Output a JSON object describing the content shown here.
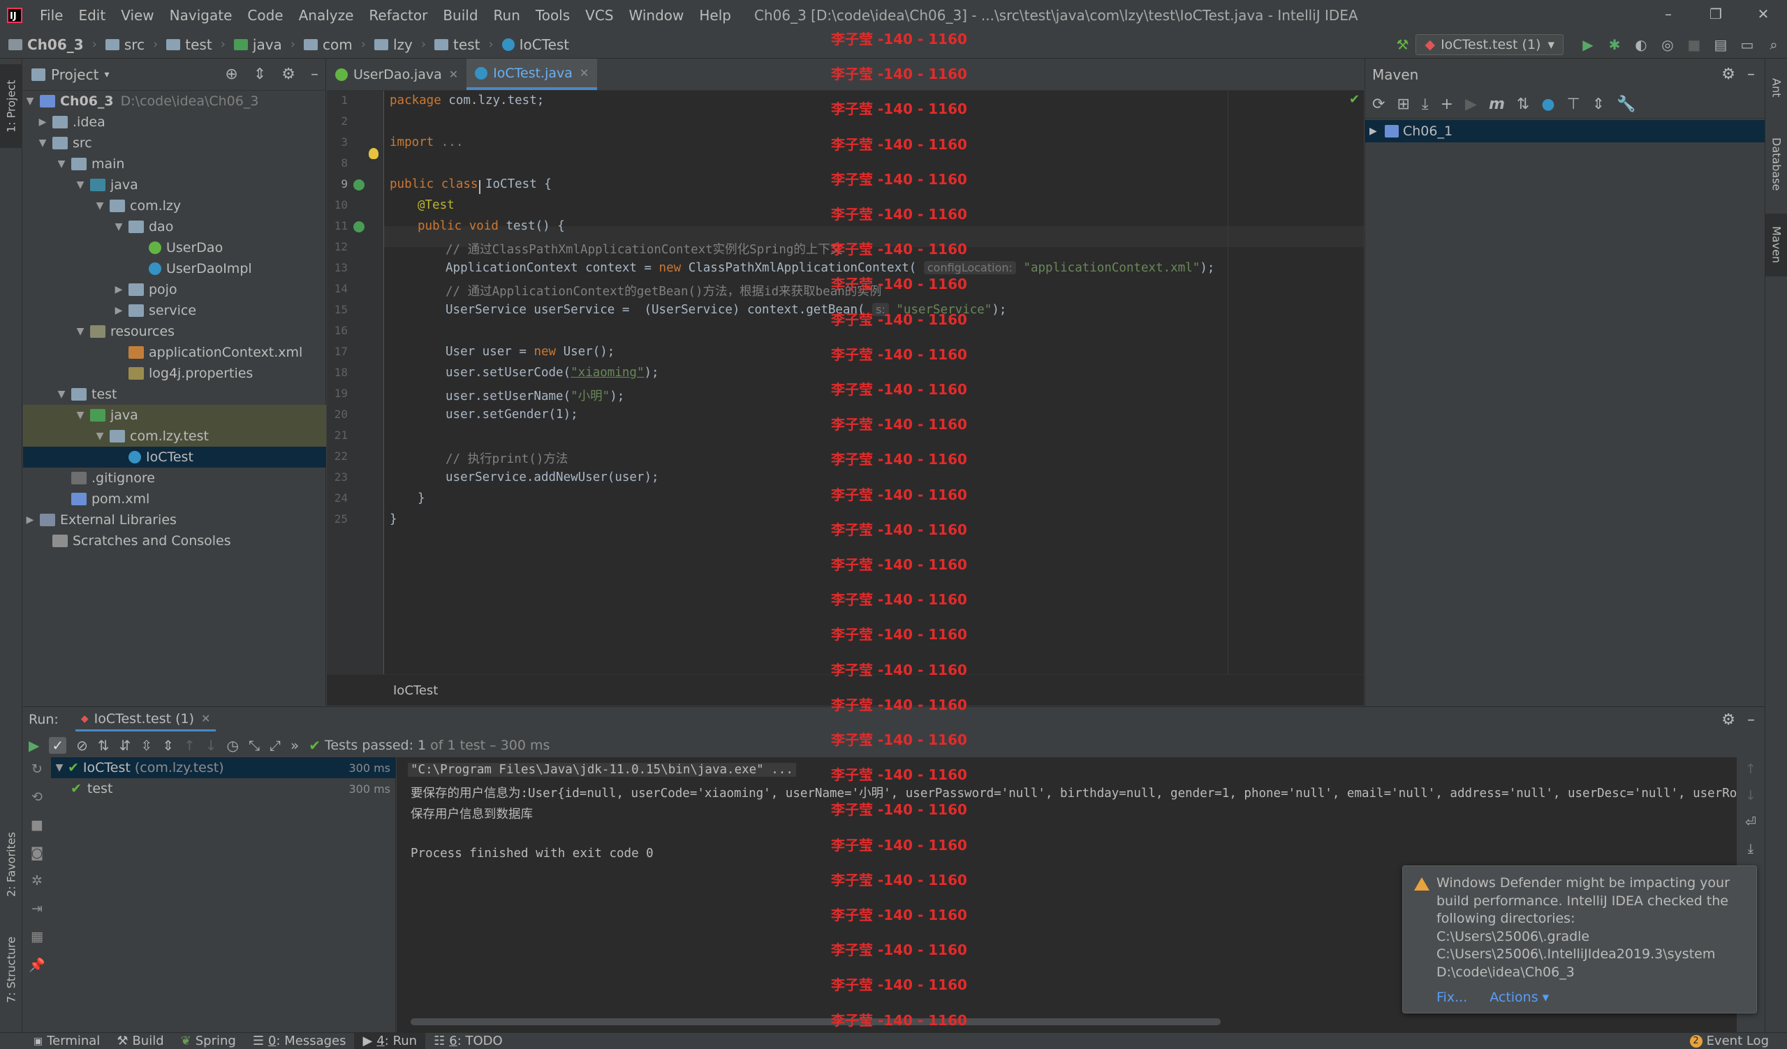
{
  "menu": [
    "File",
    "Edit",
    "View",
    "Navigate",
    "Code",
    "Analyze",
    "Refactor",
    "Build",
    "Run",
    "Tools",
    "VCS",
    "Window",
    "Help"
  ],
  "window_title": "Ch06_3 [D:\\code\\idea\\Ch06_3] - ...\\src\\test\\java\\com\\lzy\\test\\IoCTest.java - IntelliJ IDEA",
  "window_controls": {
    "minimize": "–",
    "restore": "❐",
    "close": "✕"
  },
  "breadcrumbs": [
    "Ch06_3",
    "src",
    "test",
    "java",
    "com",
    "lzy",
    "test",
    "IoCTest"
  ],
  "run_config": "IoCTest.test (1)",
  "left_stripe": {
    "project": "1: Project",
    "favorites": "2: Favorites",
    "structure": "7: Structure"
  },
  "right_stripe": {
    "ant": "Ant",
    "database": "Database",
    "maven": "Maven"
  },
  "project_panel": {
    "title": "Project",
    "tree": [
      {
        "label": "Ch06_3",
        "dim": "D:\\code\\idea\\Ch06_3"
      },
      {
        "label": ".idea"
      },
      {
        "label": "src"
      },
      {
        "label": "main"
      },
      {
        "label": "java"
      },
      {
        "label": "com.lzy"
      },
      {
        "label": "dao"
      },
      {
        "label": "UserDao"
      },
      {
        "label": "UserDaoImpl"
      },
      {
        "label": "pojo"
      },
      {
        "label": "service"
      },
      {
        "label": "resources"
      },
      {
        "label": "applicationContext.xml"
      },
      {
        "label": "log4j.properties"
      },
      {
        "label": "test"
      },
      {
        "label": "java"
      },
      {
        "label": "com.lzy.test"
      },
      {
        "label": "IoCTest"
      },
      {
        "label": ".gitignore"
      },
      {
        "label": "pom.xml"
      },
      {
        "label": "External Libraries"
      },
      {
        "label": "Scratches and Consoles"
      }
    ]
  },
  "editor": {
    "tabs": [
      {
        "label": "UserDao.java",
        "active": false
      },
      {
        "label": "IoCTest.java",
        "active": true
      }
    ],
    "line_numbers": [
      "1",
      "2",
      "3",
      "8",
      "9",
      "10",
      "11",
      "12",
      "13",
      "14",
      "15",
      "16",
      "17",
      "18",
      "19",
      "20",
      "21",
      "22",
      "23",
      "24",
      "25"
    ],
    "lines": {
      "l1_kw": "package",
      "l1_rest": " com.lzy.test;",
      "l3_kw": "import",
      "l3_rest": " ...",
      "l9_kw": "public class",
      "l9_rest": " IoCTest {",
      "l10": "@Test",
      "l11_kw": "public void",
      "l11_rest": " test() {",
      "l12": "// 通过ClassPathXmlApplicationContext实例化Spring的上下文",
      "l13_a": "ApplicationContext context = ",
      "l13_kw": "new",
      "l13_b": " ClassPathXmlApplicationContext(",
      "l13_hint": "configLocation:",
      "l13_str": "\"applicationContext.xml\"",
      "l13_c": ");",
      "l14": "// 通过ApplicationContext的getBean()方法，根据id来获取bean的实例",
      "l15_a": "UserService userService =  (UserService) context.getBean(",
      "l15_hint": "s:",
      "l15_str": "\"userService\"",
      "l15_c": ");",
      "l17_a": "User user = ",
      "l17_kw": "new",
      "l17_b": " User();",
      "l18_a": "user.setUserCode(",
      "l18_str": "\"xiaoming\"",
      "l18_c": ");",
      "l19_a": "user.setUserName(",
      "l19_str": "\"小明\"",
      "l19_c": ");",
      "l20": "user.setGender(1);",
      "l22": "// 执行print()方法",
      "l23": "userService.addNewUser(user);",
      "l24": "}",
      "l25": "}"
    },
    "footer_breadcrumb": "IoCTest"
  },
  "maven": {
    "title": "Maven",
    "project": "Ch06_1"
  },
  "run": {
    "label": "Run:",
    "tab": "IoCTest.test (1)",
    "status_bold": "Tests passed: 1",
    "status_rest": " of 1 test – 300 ms",
    "tree": [
      {
        "label": "IoCTest",
        "dim": "(com.lzy.test)",
        "time": "300 ms"
      },
      {
        "label": "test",
        "time": "300 ms"
      }
    ],
    "console": [
      "\"C:\\Program Files\\Java\\jdk-11.0.15\\bin\\java.exe\" ...",
      "要保存的用户信息为:User{id=null, userCode='xiaoming', userName='小明', userPassword='null', birthday=null, gender=1, phone='null', email='null', address='null', userDesc='null', userRole=null",
      "保存用户信息到数据库",
      "",
      "Process finished with exit code 0"
    ]
  },
  "notification": {
    "lines": [
      "Windows Defender might be impacting your",
      "build performance. IntelliJ IDEA checked the",
      "following directories:",
      "C:\\Users\\25006\\.gradle",
      "C:\\Users\\25006\\.IntelliJIdea2019.3\\system",
      "D:\\code\\idea\\Ch06_3"
    ],
    "fix": "Fix...",
    "actions": "Actions ▾"
  },
  "statusbar": {
    "terminal": "Terminal",
    "build": "Build",
    "spring": "Spring",
    "messages_num": "0",
    "messages": ": Messages",
    "run_num": "4",
    "run": ": Run",
    "todo_num": "6",
    "todo": ": TODO",
    "eventlog_count": "2",
    "eventlog": "Event Log"
  },
  "watermark": "李子莹 -140 - 1160",
  "colors": {
    "accent": "#4a88c7",
    "selection": "#0d293e",
    "watermark": "#e32b2b",
    "pass": "#499c54"
  }
}
